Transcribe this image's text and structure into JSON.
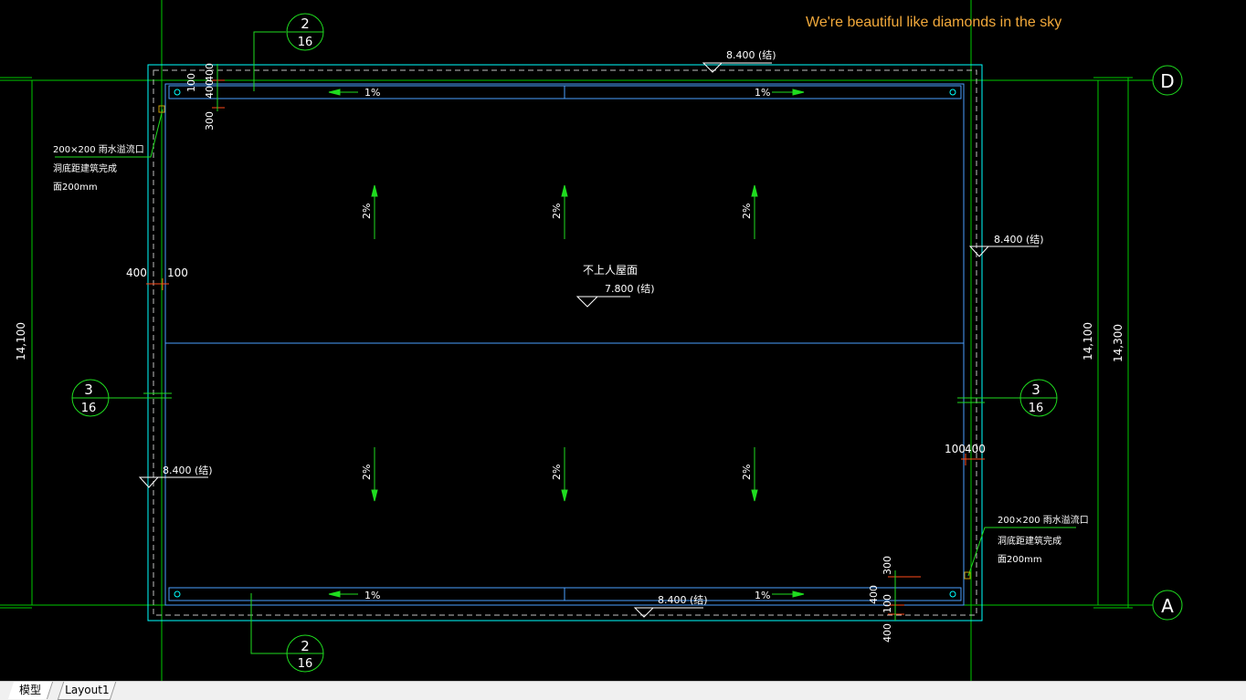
{
  "banner": "We're beautiful like diamonds in the sky",
  "tabs": {
    "model": "模型",
    "layout1": "Layout1"
  },
  "colors": {
    "background": "#000000",
    "grid_line": "#00c800",
    "outline": "#00ffff",
    "inner": "#4aa0ff",
    "text": "#ffffff",
    "arrow": "#1fdc1f",
    "dim_tick": "#ff4a1a",
    "banner": "#f2a93b"
  },
  "axes": {
    "D": "D",
    "A": "A"
  },
  "callouts": {
    "top": {
      "num": "2",
      "den": "16"
    },
    "bottom": {
      "num": "2",
      "den": "16"
    },
    "left": {
      "num": "3",
      "den": "16"
    },
    "right": {
      "num": "3",
      "den": "16"
    }
  },
  "elevations": {
    "top": "8.400 (结)",
    "right": "8.400 (结)",
    "left": "8.400 (结)",
    "bottom": "8.400 (结)",
    "center": "7.800 (结)"
  },
  "center_label": "不上人屋面",
  "slopes": {
    "gutter": "1%",
    "roof": "2%"
  },
  "overflow_note": {
    "line1": "200×200 雨水溢流口",
    "line2": "洞底距建筑完成",
    "line3": "面200mm"
  },
  "dimensions": {
    "left_total": "14,100",
    "right_inner": "14,100",
    "right_outer": "14,300",
    "left_offset_a": "400",
    "left_offset_b": "100",
    "right_offset_a": "100",
    "right_offset_b": "400",
    "tl_100": "100",
    "tl_400a": "400",
    "tl_400b": "400",
    "tl_300": "300",
    "br_300": "300",
    "br_400a": "400",
    "br_100": "100",
    "br_400b": "400"
  }
}
